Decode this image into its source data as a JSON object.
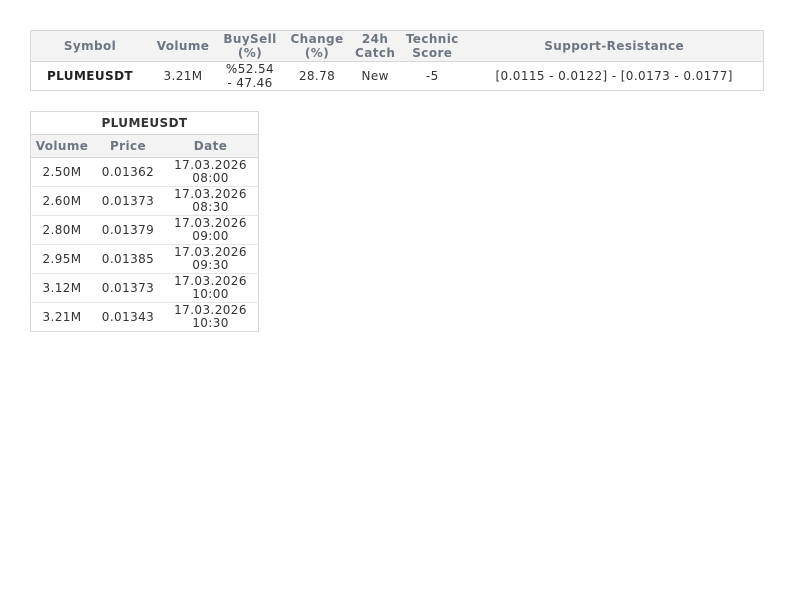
{
  "summary": {
    "headers": {
      "symbol": "Symbol",
      "volume": "Volume",
      "buysell": [
        "BuySell",
        "(%)"
      ],
      "change": [
        "Change",
        "(%)"
      ],
      "catch24h": [
        "24h",
        "Catch"
      ],
      "technic": [
        "Technic",
        "Score"
      ],
      "support": "Support-Resistance"
    },
    "row": {
      "symbol": "PLUMEUSDT",
      "volume": "3.21M",
      "buysell": [
        "%52.54",
        "- 47.46"
      ],
      "change": "28.78",
      "catch24h": "New",
      "technic": "-5",
      "support": "[0.0115 - 0.0122] - [0.0173 - 0.0177]"
    }
  },
  "history": {
    "title": "PLUMEUSDT",
    "headers": {
      "volume": "Volume",
      "price": "Price",
      "date": "Date"
    },
    "rows": [
      {
        "volume": "2.50M",
        "price": "0.01362",
        "date": "17.03.2026",
        "time": "08:00"
      },
      {
        "volume": "2.60M",
        "price": "0.01373",
        "date": "17.03.2026",
        "time": "08:30"
      },
      {
        "volume": "2.80M",
        "price": "0.01379",
        "date": "17.03.2026",
        "time": "09:00"
      },
      {
        "volume": "2.95M",
        "price": "0.01385",
        "date": "17.03.2026",
        "time": "09:30"
      },
      {
        "volume": "3.12M",
        "price": "0.01373",
        "date": "17.03.2026",
        "time": "10:00"
      },
      {
        "volume": "3.21M",
        "price": "0.01343",
        "date": "17.03.2026",
        "time": "10:30"
      }
    ]
  }
}
